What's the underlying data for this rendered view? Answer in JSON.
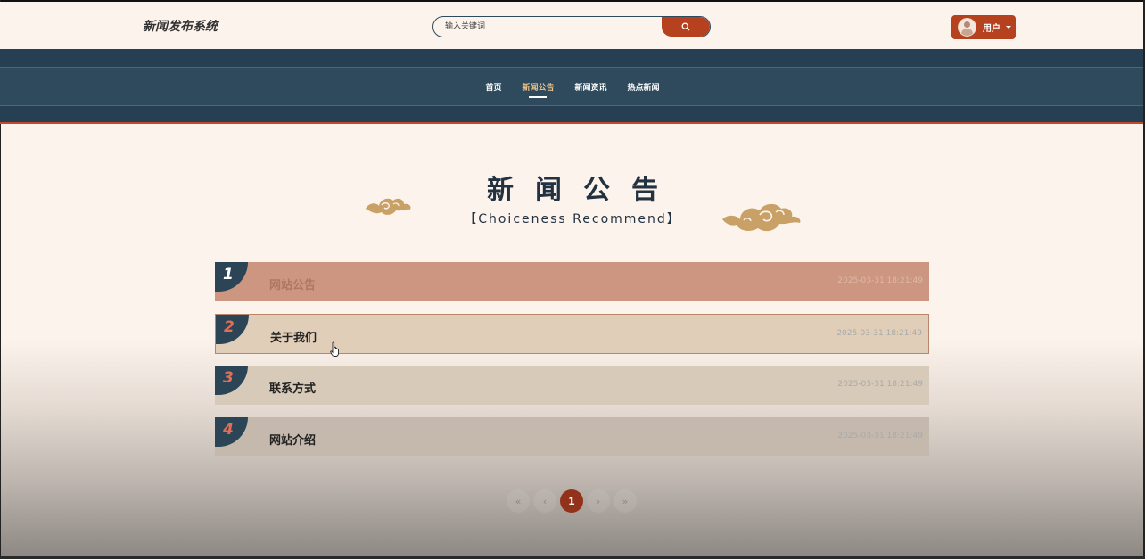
{
  "header": {
    "logo": "新闻发布系统",
    "search": {
      "placeholder": "输入关键词"
    },
    "user_label": "用户"
  },
  "nav": {
    "items": [
      "首页",
      "新闻公告",
      "新闻资讯",
      "热点新闻"
    ],
    "active_index": 1
  },
  "section": {
    "title": "新闻公告",
    "subtitle": "【Choiceness Recommend】"
  },
  "notices": [
    {
      "index": "1",
      "title": "网站公告",
      "date": "2025-03-31 18:21:49"
    },
    {
      "index": "2",
      "title": "关于我们",
      "date": "2025-03-31 18:21:49"
    },
    {
      "index": "3",
      "title": "联系方式",
      "date": "2025-03-31 18:21:49"
    },
    {
      "index": "4",
      "title": "网站介绍",
      "date": "2025-03-31 18:21:49"
    }
  ],
  "pagination": {
    "first": "«",
    "prev": "‹",
    "current": "1",
    "next": "›",
    "last": "»"
  },
  "colors": {
    "accent": "#b5411f",
    "nav_bg": "#2e4a5c",
    "page_bg": "#fcf3ec",
    "cloud": "#c9a065"
  }
}
